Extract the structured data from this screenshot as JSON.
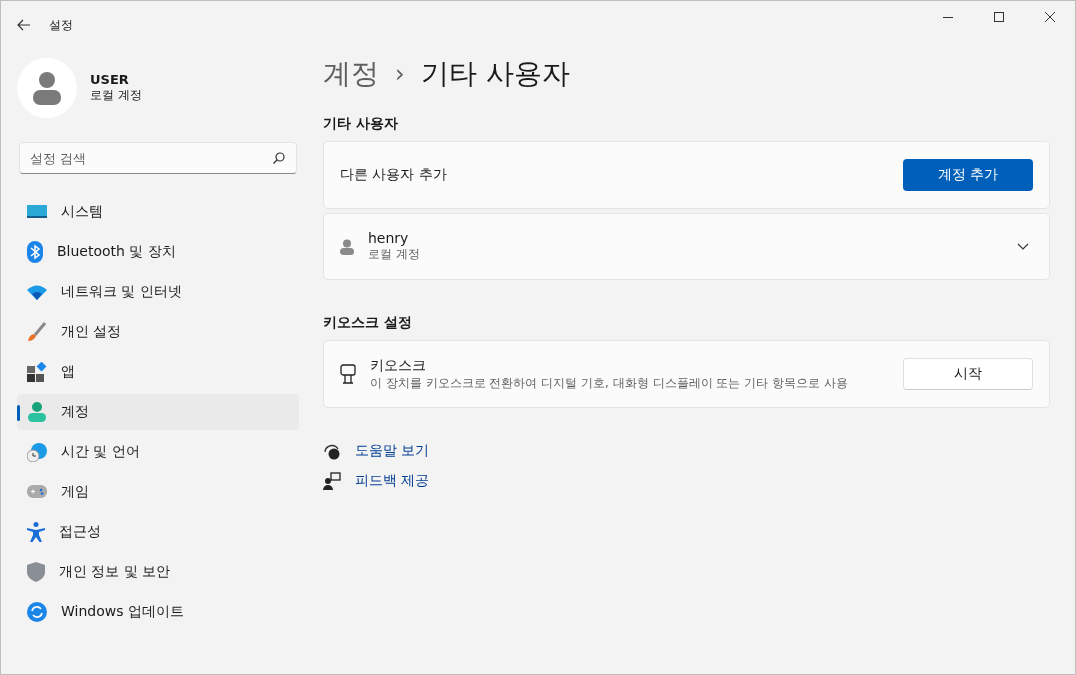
{
  "window": {
    "title": "설정"
  },
  "profile": {
    "name": "USER",
    "type": "로컬 계정"
  },
  "search": {
    "placeholder": "설정 검색"
  },
  "sidebar": {
    "items": [
      {
        "label": "시스템",
        "kind": "system",
        "selected": false
      },
      {
        "label": "Bluetooth 및 장치",
        "kind": "bluetooth",
        "selected": false
      },
      {
        "label": "네트워크 및 인터넷",
        "kind": "network",
        "selected": false
      },
      {
        "label": "개인 설정",
        "kind": "brush",
        "selected": false
      },
      {
        "label": "앱",
        "kind": "apps",
        "selected": false
      },
      {
        "label": "계정",
        "kind": "account",
        "selected": true
      },
      {
        "label": "시간 및 언어",
        "kind": "time",
        "selected": false
      },
      {
        "label": "게임",
        "kind": "game",
        "selected": false
      },
      {
        "label": "접근성",
        "kind": "access",
        "selected": false
      },
      {
        "label": "개인 정보 및 보안",
        "kind": "shield",
        "selected": false
      },
      {
        "label": "Windows 업데이트",
        "kind": "update",
        "selected": false
      }
    ]
  },
  "breadcrumb": {
    "parent": "계정",
    "separator": "›",
    "current": "기타 사용자"
  },
  "other_users": {
    "heading": "기타 사용자",
    "add_label": "다른 사용자 추가",
    "add_button": "계정 추가",
    "users": [
      {
        "name": "henry",
        "type": "로컬 계정",
        "expanded": false
      }
    ]
  },
  "kiosk": {
    "heading": "키오스크 설정",
    "title": "키오스크",
    "description": "이 장치를 키오스크로 전환하여 디지털 기호, 대화형 디스플레이 또는 기타 항목으로 사용",
    "button": "시작"
  },
  "links": [
    {
      "label": "도움말 보기",
      "kind": "help"
    },
    {
      "label": "피드백 제공",
      "kind": "feedback"
    }
  ]
}
